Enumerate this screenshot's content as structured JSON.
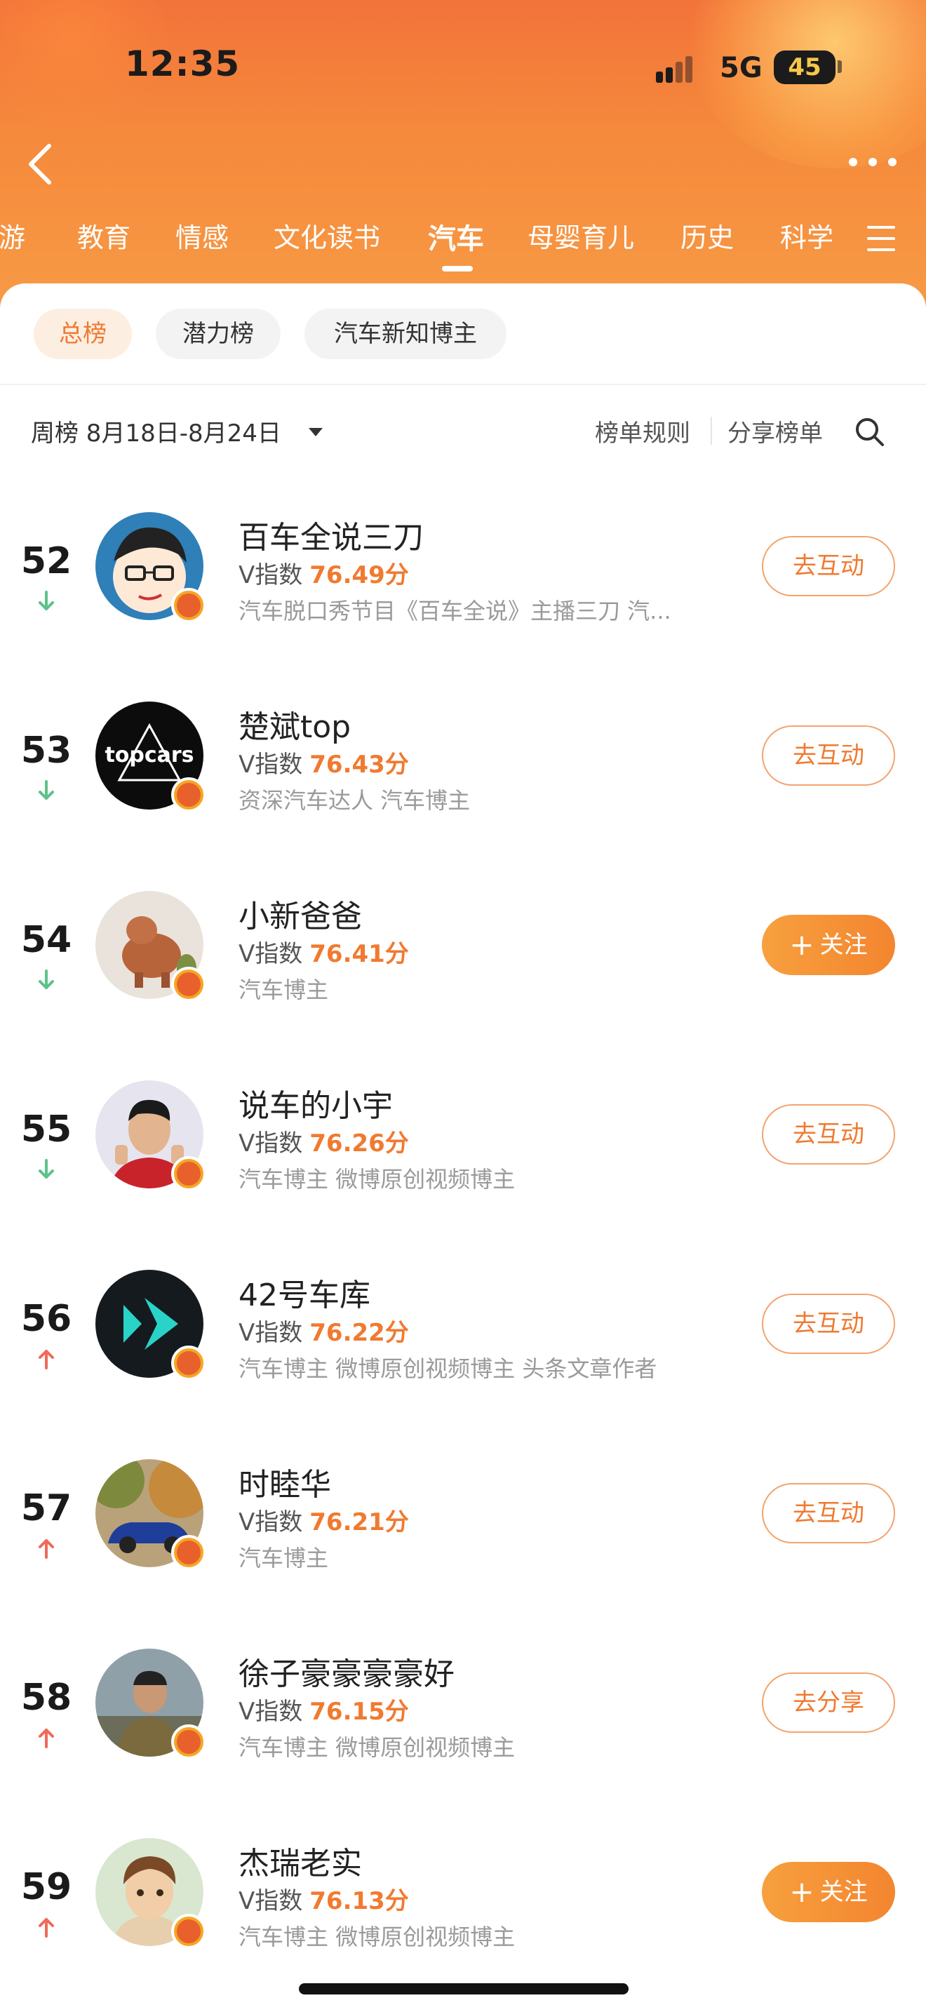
{
  "status_bar": {
    "time": "12:35",
    "network": "5G",
    "battery": "45"
  },
  "category_tabs": [
    {
      "label": "旅游"
    },
    {
      "label": "教育"
    },
    {
      "label": "情感"
    },
    {
      "label": "文化读书"
    },
    {
      "label": "汽车",
      "active": true
    },
    {
      "label": "母婴育儿"
    },
    {
      "label": "历史"
    },
    {
      "label": "科学"
    }
  ],
  "sub_tabs": [
    {
      "label": "总榜",
      "active": true
    },
    {
      "label": "潜力榜"
    },
    {
      "label": "汽车新知博主"
    }
  ],
  "toolbar": {
    "week": "周榜 8月18日-8月24日",
    "rules": "榜单规则",
    "share": "分享榜单"
  },
  "score_prefix": "V指数",
  "colors": {
    "accent": "#f07a30",
    "trend_down": "#5cc28a",
    "trend_up": "#ef6a5a"
  },
  "rankings": [
    {
      "rank": "52",
      "trend": "down",
      "name": "百车全说三刀",
      "score": "76.49分",
      "desc": "汽车脱口秀节目《百车全说》主播三刀 汽...",
      "action": "去互动",
      "action_style": "outline",
      "avatar": "cartoon-man-avatar"
    },
    {
      "rank": "53",
      "trend": "down",
      "name": "楚斌top",
      "score": "76.43分",
      "desc": "资深汽车达人 汽车博主",
      "action": "去互动",
      "action_style": "outline",
      "avatar": "topcars-logo-avatar",
      "avatar_text": "topcars"
    },
    {
      "rank": "54",
      "trend": "down",
      "name": "小新爸爸",
      "score": "76.41分",
      "desc": "汽车博主",
      "action": "关注",
      "action_style": "fill",
      "avatar": "toy-animal-avatar"
    },
    {
      "rank": "55",
      "trend": "down",
      "name": "说车的小宇",
      "score": "76.26分",
      "desc": "汽车博主 微博原创视频博主",
      "action": "去互动",
      "action_style": "outline",
      "avatar": "man-thumbs-up-avatar"
    },
    {
      "rank": "56",
      "trend": "up",
      "name": "42号车库",
      "score": "76.22分",
      "desc": "汽车博主 微博原创视频博主 头条文章作者",
      "action": "去互动",
      "action_style": "outline",
      "avatar": "garage42-logo-avatar"
    },
    {
      "rank": "57",
      "trend": "up",
      "name": "时睦华",
      "score": "76.21分",
      "desc": "汽车博主",
      "action": "去互动",
      "action_style": "outline",
      "avatar": "blue-car-avatar"
    },
    {
      "rank": "58",
      "trend": "up",
      "name": "徐子豪豪豪豪好",
      "score": "76.15分",
      "desc": "汽车博主 微博原创视频博主",
      "action": "去分享",
      "action_style": "outline",
      "avatar": "man-outdoor-avatar"
    },
    {
      "rank": "59",
      "trend": "up",
      "name": "杰瑞老实",
      "score": "76.13分",
      "desc": "汽车博主 微博原创视频博主",
      "action": "关注",
      "action_style": "fill",
      "avatar": "boy-portrait-avatar"
    }
  ]
}
